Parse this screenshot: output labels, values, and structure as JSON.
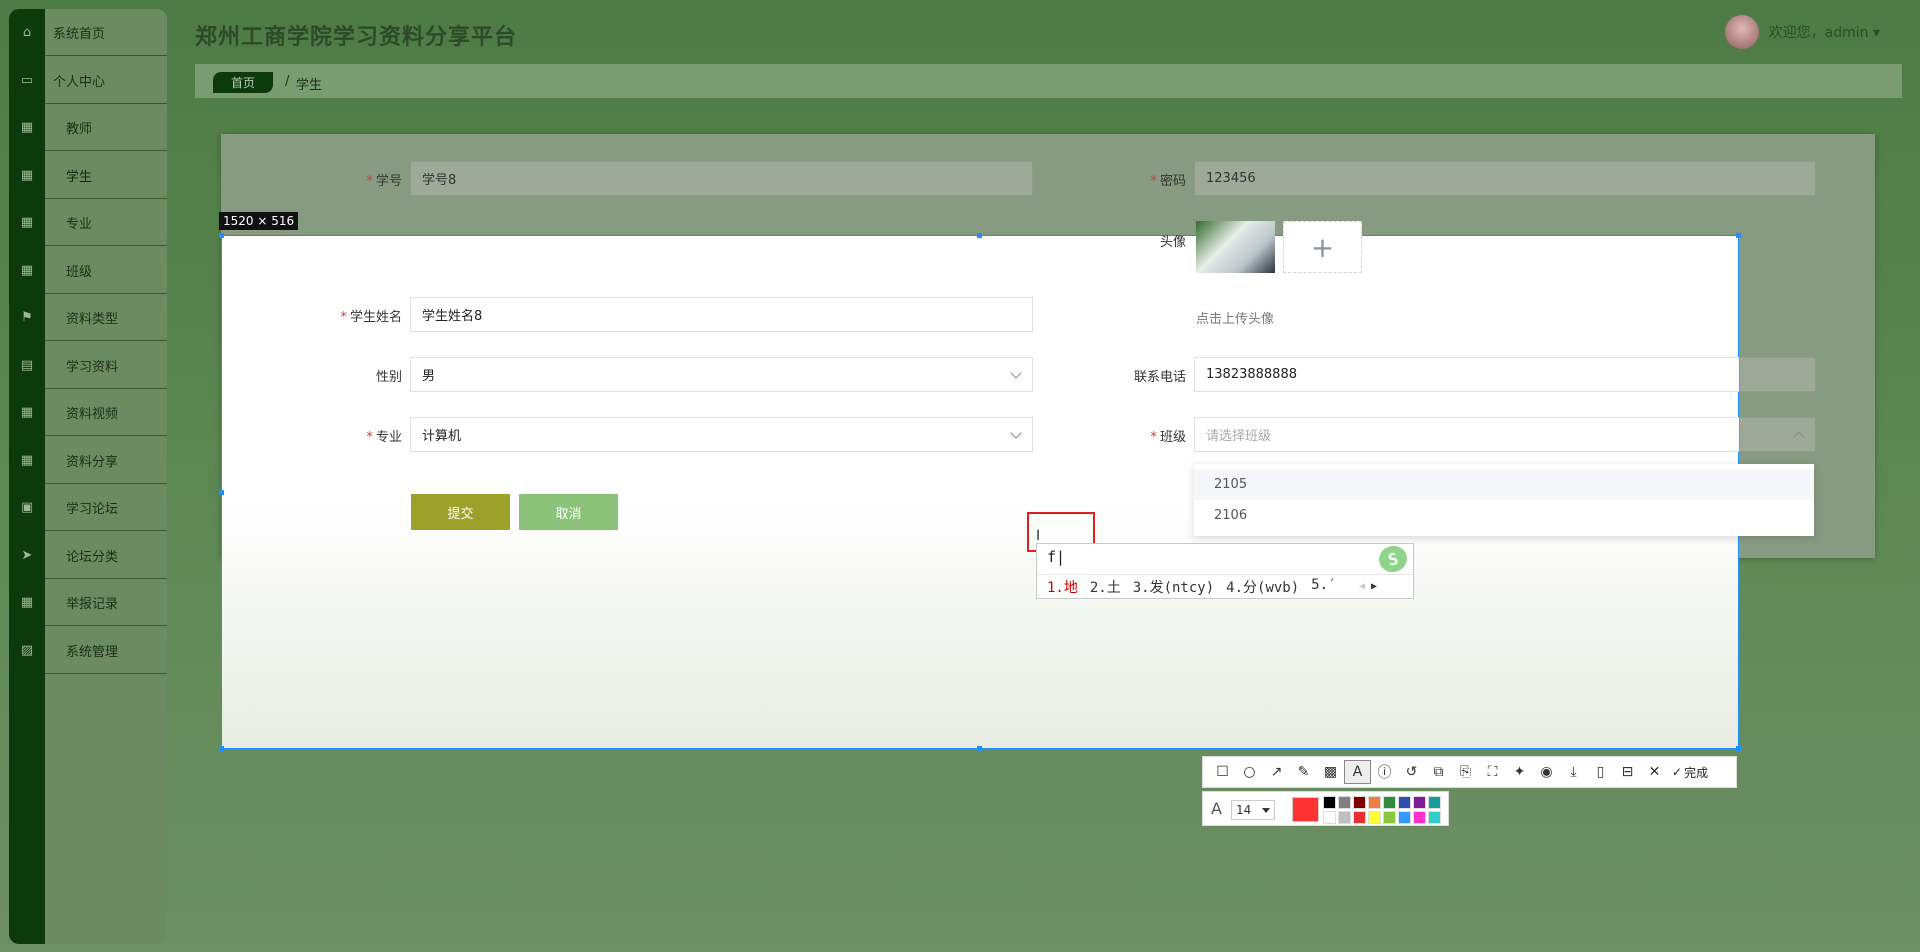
{
  "app": {
    "title": "郑州工商学院学习资料分享平台",
    "welcome": "欢迎您，admin ▾"
  },
  "breadcrumb": {
    "home": "首页",
    "sep": "/",
    "current": "学生"
  },
  "sidebar": {
    "items": [
      {
        "label": "系统首页",
        "icon": "home-icon"
      },
      {
        "label": "个人中心",
        "icon": "calendar-icon"
      },
      {
        "label": "教师",
        "icon": "grid-icon"
      },
      {
        "label": "学生",
        "icon": "grid-icon"
      },
      {
        "label": "专业",
        "icon": "grid-icon"
      },
      {
        "label": "班级",
        "icon": "grid-icon"
      },
      {
        "label": "资料类型",
        "icon": "flag-icon"
      },
      {
        "label": "学习资料",
        "icon": "book-icon"
      },
      {
        "label": "资料视频",
        "icon": "grid-icon"
      },
      {
        "label": "资料分享",
        "icon": "grid-icon"
      },
      {
        "label": "学习论坛",
        "icon": "clipboard-icon"
      },
      {
        "label": "论坛分类",
        "icon": "send-icon"
      },
      {
        "label": "举报记录",
        "icon": "grid-icon"
      },
      {
        "label": "系统管理",
        "icon": "chart-icon"
      }
    ]
  },
  "form": {
    "student_id": {
      "label": "学号",
      "value": "学号8"
    },
    "password": {
      "label": "密码",
      "value": "123456"
    },
    "avatar": {
      "label": "头像",
      "hint": "点击上传头像",
      "plus": "+"
    },
    "name": {
      "label": "学生姓名",
      "value": "学生姓名8"
    },
    "gender": {
      "label": "性别",
      "value": "男"
    },
    "phone": {
      "label": "联系电话",
      "value": "13823888888"
    },
    "major": {
      "label": "专业",
      "value": "计算机"
    },
    "class": {
      "label": "班级",
      "placeholder": "请选择班级",
      "options": [
        "2105",
        "2106"
      ]
    },
    "submit": "提交",
    "cancel": "取消"
  },
  "screenshot": {
    "size_label": "1520 × 516",
    "done_label": "完成",
    "font_size": "14",
    "current_color": "#ff3333",
    "palette": [
      "#000000",
      "#808080",
      "#800000",
      "#f08040",
      "#2e8b3a",
      "#2e4fb0",
      "#7a1c9c",
      "#1a9a9a",
      "#ffffff",
      "#c0c0c0",
      "#e83030",
      "#ffff33",
      "#8cc63f",
      "#3399ff",
      "#ff33cc",
      "#33cccc"
    ]
  },
  "ime": {
    "input": "f",
    "candidates": [
      "1.地",
      "2.土",
      "3.发(ntcy)",
      "4.分(wvb)",
      "5.′"
    ],
    "logo": "S"
  },
  "accent": {
    "dark_green": "#0d3a0d",
    "submit": "#9ca12a",
    "cancel": "#8cc27a",
    "selection": "#1e90ff"
  }
}
